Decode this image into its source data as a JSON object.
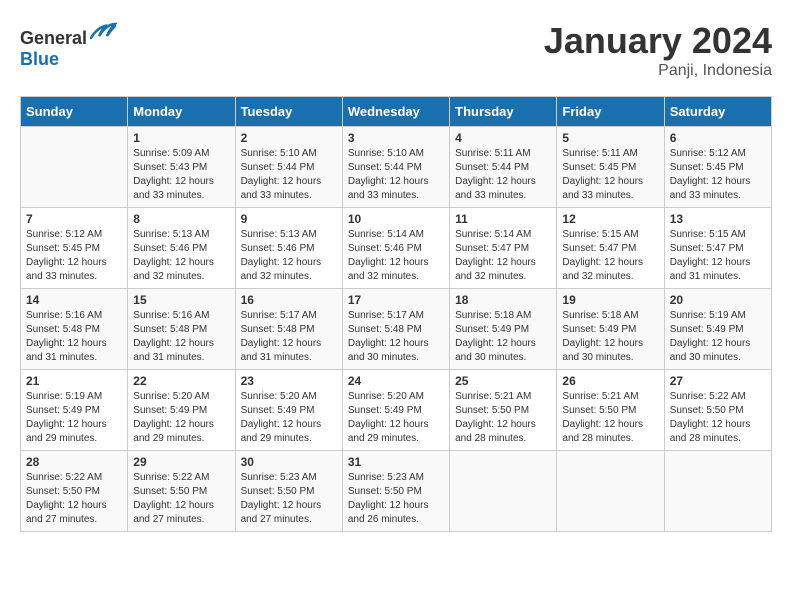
{
  "header": {
    "logo_general": "General",
    "logo_blue": "Blue",
    "month_title": "January 2024",
    "location": "Panji, Indonesia"
  },
  "weekdays": [
    "Sunday",
    "Monday",
    "Tuesday",
    "Wednesday",
    "Thursday",
    "Friday",
    "Saturday"
  ],
  "weeks": [
    [
      {
        "day": "",
        "sunrise": "",
        "sunset": "",
        "daylight": ""
      },
      {
        "day": "1",
        "sunrise": "Sunrise: 5:09 AM",
        "sunset": "Sunset: 5:43 PM",
        "daylight": "Daylight: 12 hours and 33 minutes."
      },
      {
        "day": "2",
        "sunrise": "Sunrise: 5:10 AM",
        "sunset": "Sunset: 5:44 PM",
        "daylight": "Daylight: 12 hours and 33 minutes."
      },
      {
        "day": "3",
        "sunrise": "Sunrise: 5:10 AM",
        "sunset": "Sunset: 5:44 PM",
        "daylight": "Daylight: 12 hours and 33 minutes."
      },
      {
        "day": "4",
        "sunrise": "Sunrise: 5:11 AM",
        "sunset": "Sunset: 5:44 PM",
        "daylight": "Daylight: 12 hours and 33 minutes."
      },
      {
        "day": "5",
        "sunrise": "Sunrise: 5:11 AM",
        "sunset": "Sunset: 5:45 PM",
        "daylight": "Daylight: 12 hours and 33 minutes."
      },
      {
        "day": "6",
        "sunrise": "Sunrise: 5:12 AM",
        "sunset": "Sunset: 5:45 PM",
        "daylight": "Daylight: 12 hours and 33 minutes."
      }
    ],
    [
      {
        "day": "7",
        "sunrise": "Sunrise: 5:12 AM",
        "sunset": "Sunset: 5:45 PM",
        "daylight": "Daylight: 12 hours and 33 minutes."
      },
      {
        "day": "8",
        "sunrise": "Sunrise: 5:13 AM",
        "sunset": "Sunset: 5:46 PM",
        "daylight": "Daylight: 12 hours and 32 minutes."
      },
      {
        "day": "9",
        "sunrise": "Sunrise: 5:13 AM",
        "sunset": "Sunset: 5:46 PM",
        "daylight": "Daylight: 12 hours and 32 minutes."
      },
      {
        "day": "10",
        "sunrise": "Sunrise: 5:14 AM",
        "sunset": "Sunset: 5:46 PM",
        "daylight": "Daylight: 12 hours and 32 minutes."
      },
      {
        "day": "11",
        "sunrise": "Sunrise: 5:14 AM",
        "sunset": "Sunset: 5:47 PM",
        "daylight": "Daylight: 12 hours and 32 minutes."
      },
      {
        "day": "12",
        "sunrise": "Sunrise: 5:15 AM",
        "sunset": "Sunset: 5:47 PM",
        "daylight": "Daylight: 12 hours and 32 minutes."
      },
      {
        "day": "13",
        "sunrise": "Sunrise: 5:15 AM",
        "sunset": "Sunset: 5:47 PM",
        "daylight": "Daylight: 12 hours and 31 minutes."
      }
    ],
    [
      {
        "day": "14",
        "sunrise": "Sunrise: 5:16 AM",
        "sunset": "Sunset: 5:48 PM",
        "daylight": "Daylight: 12 hours and 31 minutes."
      },
      {
        "day": "15",
        "sunrise": "Sunrise: 5:16 AM",
        "sunset": "Sunset: 5:48 PM",
        "daylight": "Daylight: 12 hours and 31 minutes."
      },
      {
        "day": "16",
        "sunrise": "Sunrise: 5:17 AM",
        "sunset": "Sunset: 5:48 PM",
        "daylight": "Daylight: 12 hours and 31 minutes."
      },
      {
        "day": "17",
        "sunrise": "Sunrise: 5:17 AM",
        "sunset": "Sunset: 5:48 PM",
        "daylight": "Daylight: 12 hours and 30 minutes."
      },
      {
        "day": "18",
        "sunrise": "Sunrise: 5:18 AM",
        "sunset": "Sunset: 5:49 PM",
        "daylight": "Daylight: 12 hours and 30 minutes."
      },
      {
        "day": "19",
        "sunrise": "Sunrise: 5:18 AM",
        "sunset": "Sunset: 5:49 PM",
        "daylight": "Daylight: 12 hours and 30 minutes."
      },
      {
        "day": "20",
        "sunrise": "Sunrise: 5:19 AM",
        "sunset": "Sunset: 5:49 PM",
        "daylight": "Daylight: 12 hours and 30 minutes."
      }
    ],
    [
      {
        "day": "21",
        "sunrise": "Sunrise: 5:19 AM",
        "sunset": "Sunset: 5:49 PM",
        "daylight": "Daylight: 12 hours and 29 minutes."
      },
      {
        "day": "22",
        "sunrise": "Sunrise: 5:20 AM",
        "sunset": "Sunset: 5:49 PM",
        "daylight": "Daylight: 12 hours and 29 minutes."
      },
      {
        "day": "23",
        "sunrise": "Sunrise: 5:20 AM",
        "sunset": "Sunset: 5:49 PM",
        "daylight": "Daylight: 12 hours and 29 minutes."
      },
      {
        "day": "24",
        "sunrise": "Sunrise: 5:20 AM",
        "sunset": "Sunset: 5:49 PM",
        "daylight": "Daylight: 12 hours and 29 minutes."
      },
      {
        "day": "25",
        "sunrise": "Sunrise: 5:21 AM",
        "sunset": "Sunset: 5:50 PM",
        "daylight": "Daylight: 12 hours and 28 minutes."
      },
      {
        "day": "26",
        "sunrise": "Sunrise: 5:21 AM",
        "sunset": "Sunset: 5:50 PM",
        "daylight": "Daylight: 12 hours and 28 minutes."
      },
      {
        "day": "27",
        "sunrise": "Sunrise: 5:22 AM",
        "sunset": "Sunset: 5:50 PM",
        "daylight": "Daylight: 12 hours and 28 minutes."
      }
    ],
    [
      {
        "day": "28",
        "sunrise": "Sunrise: 5:22 AM",
        "sunset": "Sunset: 5:50 PM",
        "daylight": "Daylight: 12 hours and 27 minutes."
      },
      {
        "day": "29",
        "sunrise": "Sunrise: 5:22 AM",
        "sunset": "Sunset: 5:50 PM",
        "daylight": "Daylight: 12 hours and 27 minutes."
      },
      {
        "day": "30",
        "sunrise": "Sunrise: 5:23 AM",
        "sunset": "Sunset: 5:50 PM",
        "daylight": "Daylight: 12 hours and 27 minutes."
      },
      {
        "day": "31",
        "sunrise": "Sunrise: 5:23 AM",
        "sunset": "Sunset: 5:50 PM",
        "daylight": "Daylight: 12 hours and 26 minutes."
      },
      {
        "day": "",
        "sunrise": "",
        "sunset": "",
        "daylight": ""
      },
      {
        "day": "",
        "sunrise": "",
        "sunset": "",
        "daylight": ""
      },
      {
        "day": "",
        "sunrise": "",
        "sunset": "",
        "daylight": ""
      }
    ]
  ]
}
